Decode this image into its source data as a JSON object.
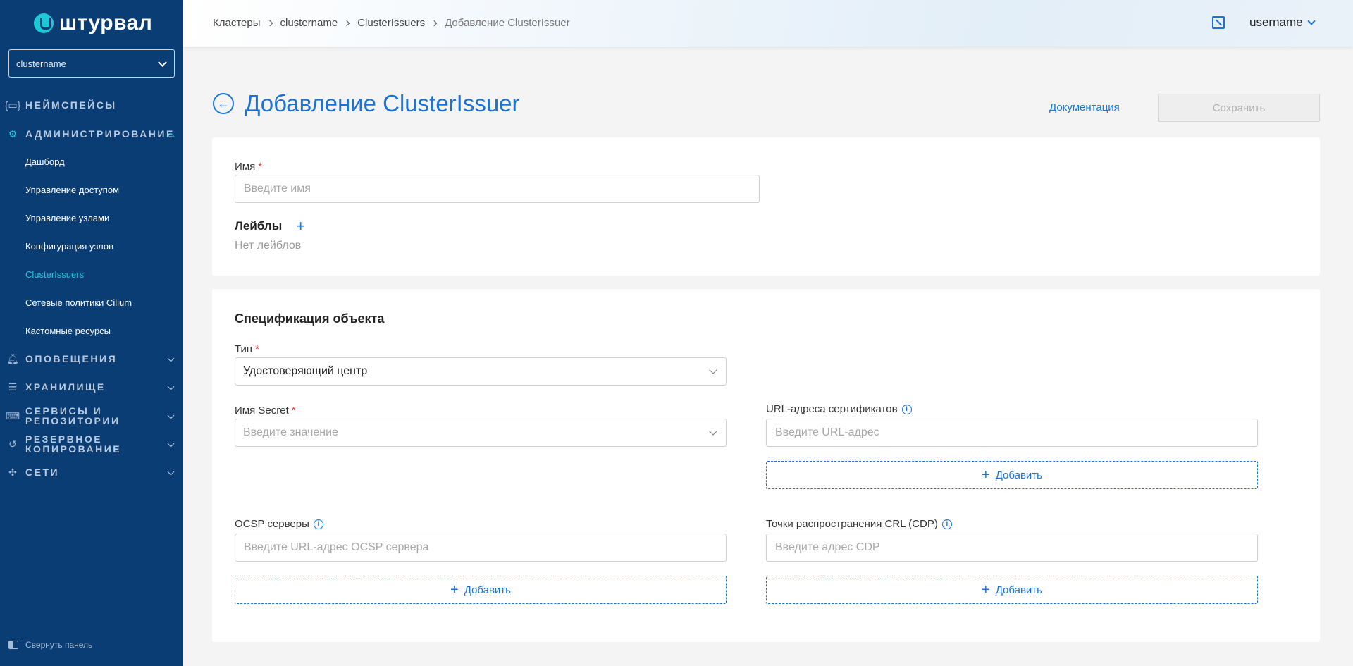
{
  "brand": {
    "name": "штурвал"
  },
  "sidebar": {
    "cluster_select": {
      "value": "clustername"
    },
    "sections": [
      {
        "label": "НЕЙМСПЕЙСЫ"
      },
      {
        "label": "АДМИНИСТРИРОВАНИЕ"
      },
      {
        "label": "ОПОВЕЩЕНИЯ"
      },
      {
        "label": "ХРАНИЛИЩЕ"
      },
      {
        "label": "СЕРВИСЫ И РЕПОЗИТОРИИ"
      },
      {
        "label": "РЕЗЕРВНОЕ КОПИРОВАНИЕ"
      },
      {
        "label": "СЕТИ"
      }
    ],
    "admin_items": [
      {
        "label": "Дашборд"
      },
      {
        "label": "Управление доступом"
      },
      {
        "label": "Управление узлами"
      },
      {
        "label": "Конфигурация узлов"
      },
      {
        "label": "ClusterIssuers"
      },
      {
        "label": "Сетевые политики Cilium"
      },
      {
        "label": "Кастомные ресурсы"
      }
    ],
    "collapse_label": "Свернуть панель"
  },
  "header": {
    "breadcrumbs": [
      "Кластеры",
      "clustername",
      "ClusterIssuers",
      "Добавление ClusterIssuer"
    ],
    "username": "username"
  },
  "page": {
    "title": "Добавление ClusterIssuer",
    "doc_link": "Документация",
    "save_label": "Сохранить"
  },
  "metadata_card": {
    "name_label": "Имя",
    "name_placeholder": "Введите имя",
    "labels_title": "Лейблы",
    "labels_add": "+",
    "labels_empty": "Нет лейблов"
  },
  "spec_card": {
    "title": "Спецификация объекта",
    "type_label": "Тип",
    "type_value": "Удостоверяющий центр",
    "secret_label": "Имя Secret",
    "secret_placeholder": "Введите значение",
    "cert_urls_label": "URL-адреса сертификатов",
    "cert_urls_placeholder": "Введите URL-адрес",
    "ocsp_label": "OCSP серверы",
    "ocsp_placeholder": "Введите URL-адрес OCSP сервера",
    "crl_label": "Точки распространения CRL (CDP)",
    "crl_placeholder": "Введите адрес CDP",
    "add_label": "Добавить"
  },
  "colors": {
    "sidebar_bg": "#0a3d73",
    "accent": "#1a73d9",
    "active_teal": "#1ec8d6",
    "required": "#e53935"
  }
}
